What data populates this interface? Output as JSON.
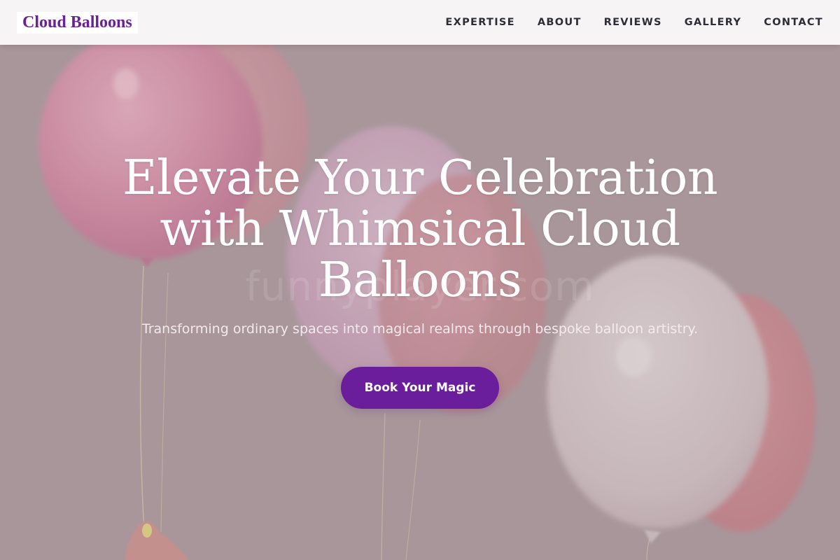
{
  "brand": {
    "name": "Cloud Balloons",
    "color": "#6b2096"
  },
  "nav": {
    "items": [
      {
        "label": "EXPERTISE"
      },
      {
        "label": "ABOUT"
      },
      {
        "label": "REVIEWS"
      },
      {
        "label": "GALLERY"
      },
      {
        "label": "CONTACT"
      }
    ]
  },
  "hero": {
    "title": "Elevate Your Celebration with Whimsical Cloud Balloons",
    "subtitle": "Transforming ordinary spaces into magical realms through bespoke balloon artistry.",
    "cta_label": "Book Your Magic",
    "watermark": "funnyplayer.com",
    "background_image": "pink-and-white-balloons-photo",
    "overlay_color": "#a7959a",
    "cta_color": "#6b1e9c"
  }
}
